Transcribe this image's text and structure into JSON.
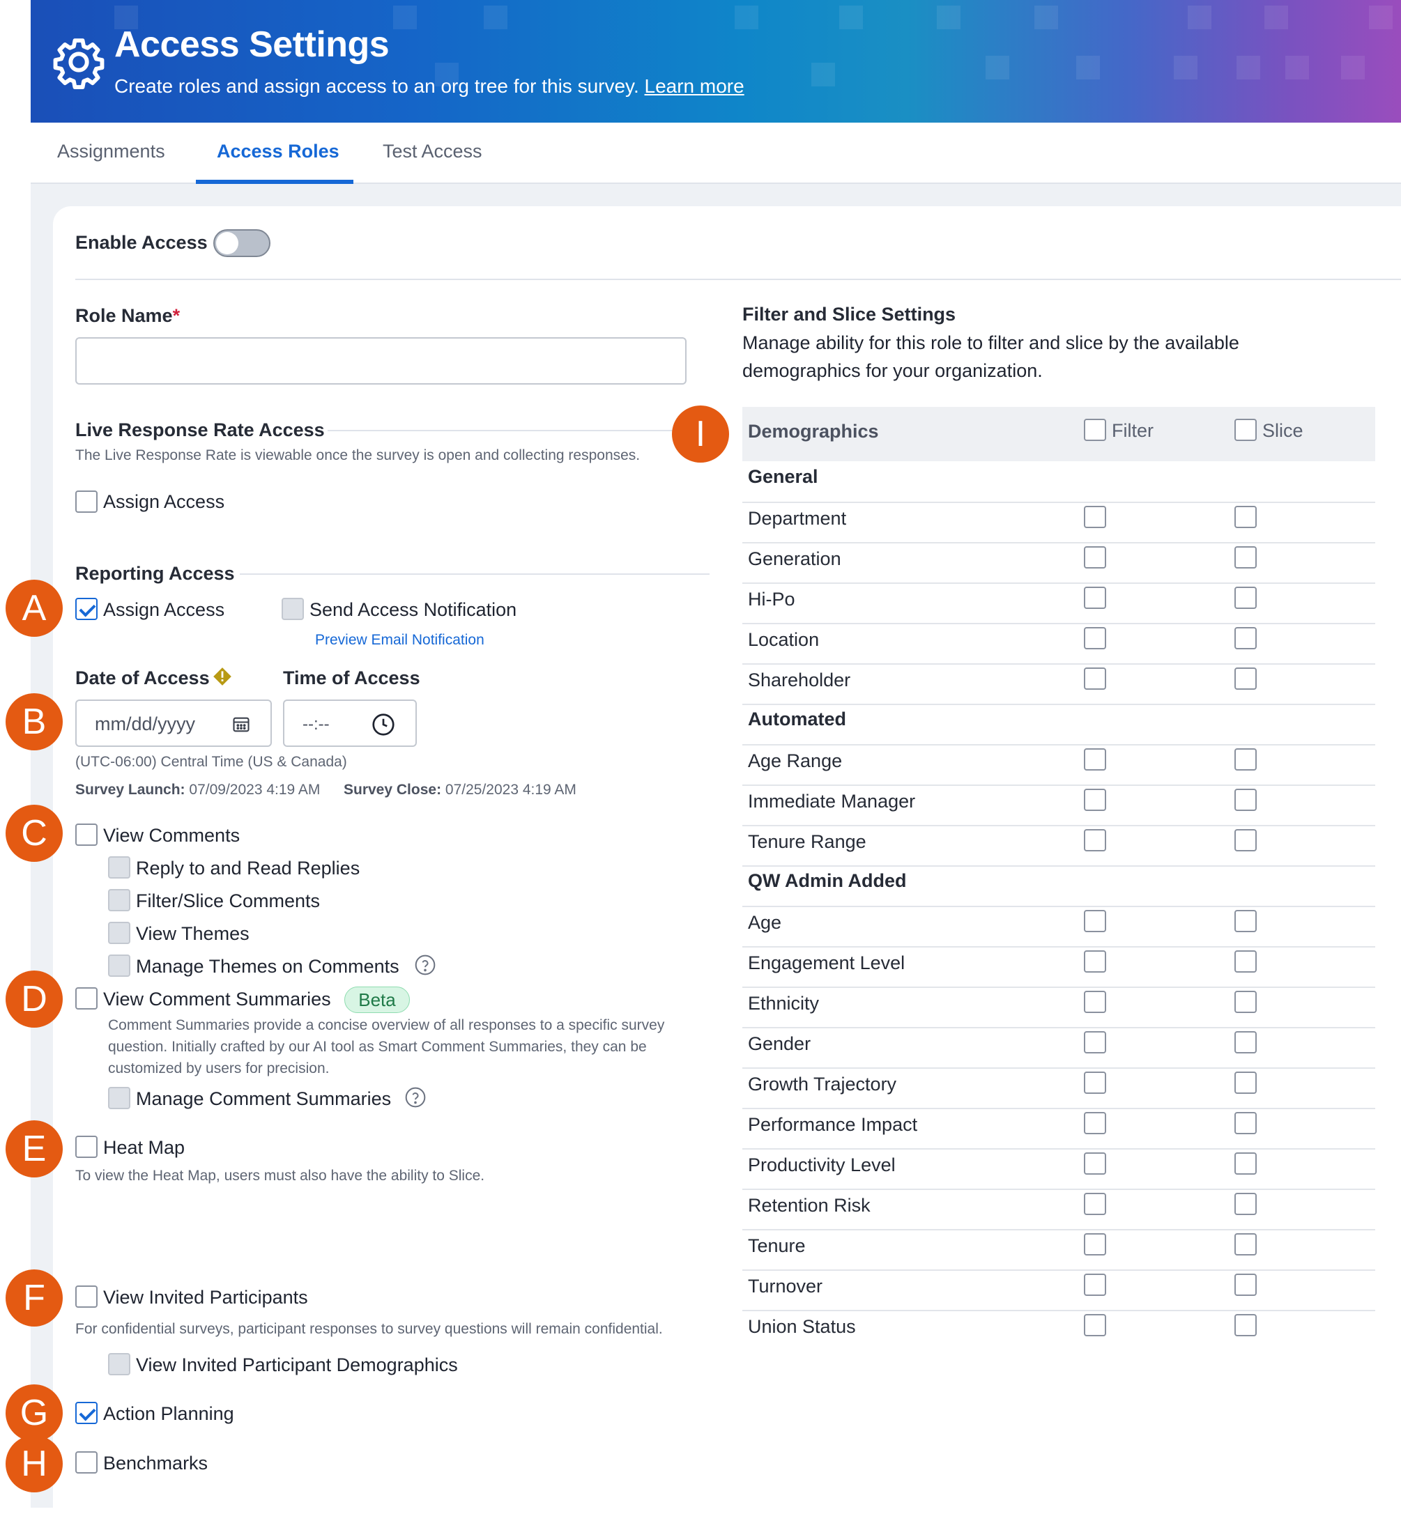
{
  "header": {
    "title": "Access Settings",
    "subtitle": "Create roles and assign access to an org tree for this survey.",
    "learn_more": "Learn more"
  },
  "tabs": [
    "Assignments",
    "Access Roles",
    "Test Access"
  ],
  "active_tab": "Access Roles",
  "enable_access": {
    "label": "Enable Access",
    "on": false
  },
  "role_name": {
    "label": "Role Name",
    "required_mark": "*",
    "value": ""
  },
  "live_response": {
    "title": "Live Response Rate Access",
    "description": "The Live Response Rate is viewable once the survey is open and collecting responses.",
    "assign_label": "Assign Access",
    "assign_checked": false
  },
  "reporting": {
    "title": "Reporting Access",
    "assign_label": "Assign Access",
    "assign_checked": true,
    "notify_label": "Send Access Notification",
    "preview_link": "Preview Email Notification",
    "date_label": "Date of Access",
    "time_label": "Time of Access",
    "date_placeholder": "mm/dd/yyyy",
    "time_placeholder": "--:--",
    "timezone": "(UTC-06:00) Central Time (US & Canada)",
    "launch_label": "Survey Launch:",
    "launch_value": "07/09/2023 4:19 AM",
    "close_label": "Survey Close:",
    "close_value": "07/25/2023 4:19 AM"
  },
  "permissions": {
    "view_comments": "View Comments",
    "reply": "Reply to and Read Replies",
    "filter_slice_comments": "Filter/Slice Comments",
    "view_themes": "View Themes",
    "manage_themes": "Manage Themes on Comments",
    "view_summaries": "View Comment Summaries",
    "beta": "Beta",
    "summaries_desc_1": "Comment Summaries provide a concise overview of all responses to a specific survey",
    "summaries_desc_2": "question. Initially crafted by our AI tool as Smart Comment Summaries, they can be",
    "summaries_desc_3": "customized by users for precision.",
    "manage_summaries": "Manage Comment Summaries",
    "heat_map": "Heat Map",
    "heat_map_desc": "To view the Heat Map, users must also have the ability to Slice.",
    "view_invited": "View Invited Participants",
    "invited_desc": "For confidential surveys, participant responses to survey questions will remain confidential.",
    "view_invited_demo": "View Invited Participant Demographics",
    "action_planning": "Action Planning",
    "action_planning_checked": true,
    "benchmarks": "Benchmarks"
  },
  "markers": [
    "A",
    "B",
    "C",
    "D",
    "E",
    "F",
    "G",
    "H",
    "I"
  ],
  "filter_slice": {
    "title": "Filter and Slice Settings",
    "desc_1": "Manage ability for this role to filter and slice by the available",
    "desc_2": "demographics for your organization.",
    "col_demographics": "Demographics",
    "col_filter": "Filter",
    "col_slice": "Slice",
    "groups": [
      {
        "name": "General",
        "items": [
          "Department",
          "Generation",
          "Hi-Po",
          "Location",
          "Shareholder"
        ]
      },
      {
        "name": "Automated",
        "items": [
          "Age Range",
          "Immediate Manager",
          "Tenure Range"
        ]
      },
      {
        "name": "QW Admin Added",
        "items": [
          "Age",
          "Engagement Level",
          "Ethnicity",
          "Gender",
          "Growth Trajectory",
          "Performance Impact",
          "Productivity Level",
          "Retention Risk",
          "Tenure",
          "Turnover",
          "Union Status"
        ]
      }
    ]
  },
  "colors": {
    "accent": "#1668d6",
    "marker": "#e45a12",
    "beta_bg": "#d8f5e4"
  }
}
